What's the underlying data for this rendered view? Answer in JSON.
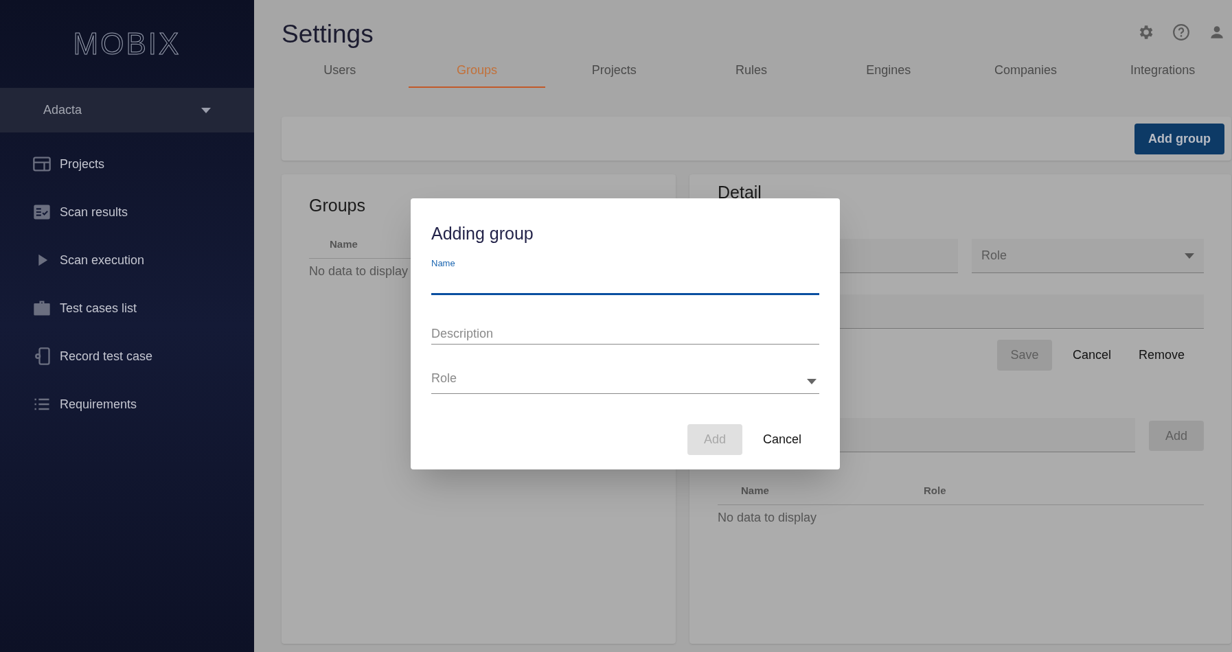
{
  "sidebar": {
    "logo": "MOBIX",
    "company_select": {
      "value": "Adacta"
    },
    "items": [
      {
        "label": "Projects",
        "kind": "panels"
      },
      {
        "label": "Scan results",
        "kind": "checklist"
      },
      {
        "label": "Scan execution",
        "kind": "play"
      },
      {
        "label": "Test cases list",
        "kind": "briefcase"
      },
      {
        "label": "Record test case",
        "kind": "phone"
      },
      {
        "label": "Requirements",
        "kind": "list"
      }
    ]
  },
  "header": {
    "title": "Settings"
  },
  "tabs": [
    {
      "label": "Users",
      "selected": false
    },
    {
      "label": "Groups",
      "selected": true
    },
    {
      "label": "Projects",
      "selected": false
    },
    {
      "label": "Rules",
      "selected": false
    },
    {
      "label": "Engines",
      "selected": false
    },
    {
      "label": "Companies",
      "selected": false
    },
    {
      "label": "Integrations",
      "selected": false
    }
  ],
  "toolbar": {
    "button": "Add group"
  },
  "groups_panel": {
    "title": "Groups",
    "columns": [
      "Name"
    ],
    "empty_text": "No data to display"
  },
  "detail_panel": {
    "title": "Detail",
    "role_select": {
      "placeholder": "Role"
    },
    "buttons": [
      {
        "label": "Save",
        "disabled": true
      },
      {
        "label": "Cancel",
        "disabled": false
      },
      {
        "label": "Remove",
        "disabled": false
      }
    ],
    "add_button": {
      "label": "Add",
      "disabled": true
    },
    "columns": [
      "Name",
      "Role"
    ],
    "empty_text": "No data to display"
  },
  "dialog": {
    "title": "Adding group",
    "fields": [
      {
        "kind": "text",
        "label": "Name",
        "focused": true
      },
      {
        "kind": "text",
        "placeholder": "Description",
        "focused": false
      },
      {
        "kind": "select",
        "placeholder": "Role",
        "focused": false
      }
    ],
    "buttons": [
      {
        "label": "Add",
        "disabled": true
      },
      {
        "label": "Cancel",
        "disabled": false
      }
    ]
  }
}
